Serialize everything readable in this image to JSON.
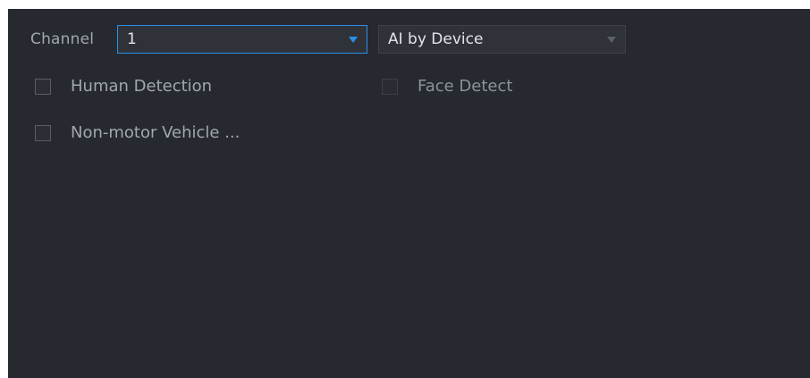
{
  "channel": {
    "label": "Channel",
    "selected": "1"
  },
  "ai_mode": {
    "selected": "AI by Device"
  },
  "options": [
    {
      "label": "Human Detection",
      "checked": false,
      "enabled": true
    },
    {
      "label": "Face Detect",
      "checked": false,
      "enabled": false
    },
    {
      "label": "Non-motor Vehicle ...",
      "checked": false,
      "enabled": true
    }
  ],
  "colors": {
    "panel_bg": "#272931",
    "accent": "#2b8fe6",
    "text": "#a2a6ae",
    "value_text": "#e3e5e8"
  },
  "icons": {
    "dropdown": "caret-down-icon",
    "checkbox": "checkbox-unchecked-icon"
  }
}
